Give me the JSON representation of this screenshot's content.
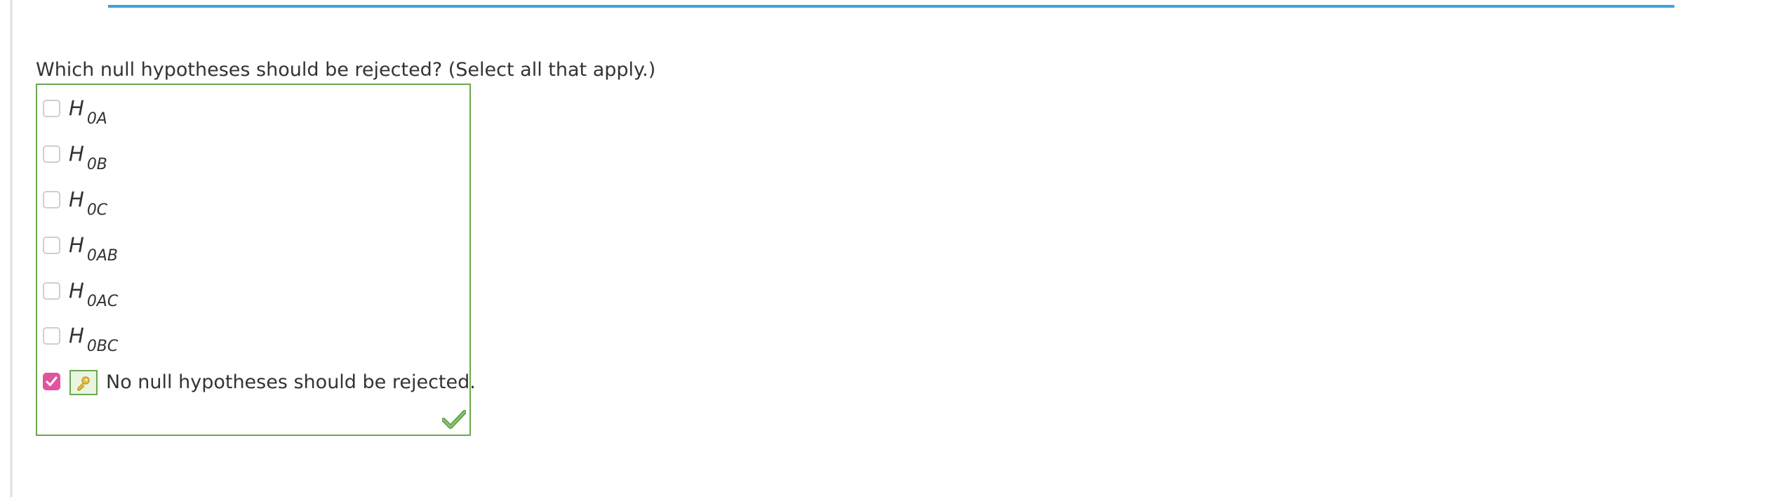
{
  "question": {
    "text": "Which null hypotheses should be rejected? (Select all that apply.)"
  },
  "options": [
    {
      "main": "H",
      "sub": "0A",
      "checked": false
    },
    {
      "main": "H",
      "sub": "0B",
      "checked": false
    },
    {
      "main": "H",
      "sub": "0C",
      "checked": false
    },
    {
      "main": "H",
      "sub": "0AB",
      "checked": false
    },
    {
      "main": "H",
      "sub": "0AC",
      "checked": false
    },
    {
      "main": "H",
      "sub": "0BC",
      "checked": false
    }
  ],
  "none_option": {
    "label": "No null hypotheses should be rejected.",
    "checked": true
  },
  "icons": {
    "key": "key-icon",
    "correct": "checkmark-icon"
  },
  "colors": {
    "accent_line": "#3aa3dc",
    "correct_border": "#6aa84f",
    "checkbox_checked": "#e0559d"
  }
}
